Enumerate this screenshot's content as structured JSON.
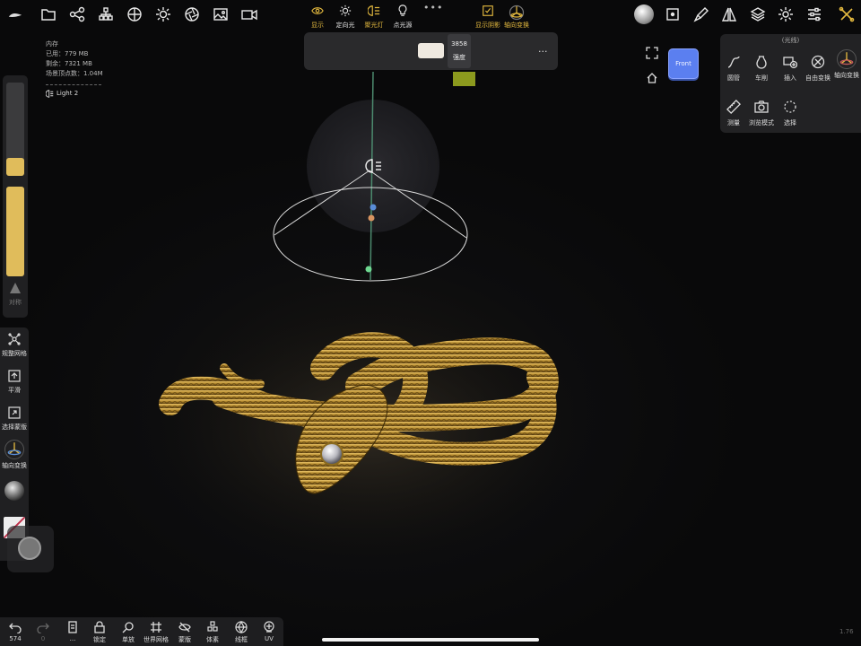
{
  "top_toolbar": {
    "left_icons": [
      "nomad-logo-icon",
      "folder-icon",
      "share-graph-icon",
      "scene-tree-icon",
      "material-grid-icon",
      "sun-icon",
      "aperture-icon",
      "image-icon",
      "video-icon"
    ],
    "right_icons": [
      "material-ball-icon",
      "mask-icon",
      "paint-brush-icon",
      "symmetry-icon",
      "layers-icon",
      "gear-icon",
      "sliders-icon",
      "tools-icon"
    ]
  },
  "memory": {
    "title": "内存",
    "used": "已用：779 MB",
    "free": "剩余：7321 MB",
    "vertices": "场景顶点数：1.04M"
  },
  "light_label": "Light 2",
  "light_toolbar": {
    "items": [
      {
        "label": "显示",
        "icon": "eye-icon"
      },
      {
        "label": "定向光",
        "icon": "sun-icon"
      },
      {
        "label": "聚光灯",
        "icon": "spotlight-icon"
      },
      {
        "label": "点光源",
        "icon": "lightbulb-icon"
      }
    ],
    "intensity_value": "3858",
    "intensity_label": "强度",
    "shadow_label": "显示阴影",
    "transform_label": "轴向变换",
    "more": "..."
  },
  "view_cube_label": "Front",
  "right_panel": {
    "title": "(光线)",
    "tools": [
      {
        "label": "圆管",
        "icon": "tube-curve-icon"
      },
      {
        "label": "车削",
        "icon": "lathe-vase-icon"
      },
      {
        "label": "插入",
        "icon": "insert-plus-icon"
      },
      {
        "label": "自由变换",
        "icon": "free-transform-icon"
      },
      {
        "label": "轴向变换",
        "icon": "gizmo-icon"
      },
      {
        "label": "测量",
        "icon": "ruler-icon"
      },
      {
        "label": "浏览模式",
        "icon": "camera-icon"
      },
      {
        "label": "选择",
        "icon": "lasso-select-icon"
      }
    ]
  },
  "left_sliders": {
    "symmetry_label": "对称",
    "radius_level": 0.1,
    "intensity_level": 1.0
  },
  "left_tools": [
    {
      "label": "规整网格",
      "icon": "remesh-icon"
    },
    {
      "label": "平滑",
      "icon": "smooth-icon"
    },
    {
      "label": "选择蒙版",
      "icon": "select-mask-icon"
    },
    {
      "label": "轴向变换",
      "icon": "gizmo-icon"
    }
  ],
  "bottom_bar": {
    "undo_count": "574",
    "redo_count": "0",
    "items": [
      {
        "label": "...",
        "icon": "menu-icon"
      },
      {
        "label": "锁定",
        "icon": "lock-icon"
      },
      {
        "label": "单放",
        "icon": "solo-search-icon"
      },
      {
        "label": "世界网格",
        "icon": "grid-icon"
      },
      {
        "label": "蒙版",
        "icon": "hide-eye-icon"
      },
      {
        "label": "体素",
        "icon": "voxel-icon"
      },
      {
        "label": "线框",
        "icon": "wireframe-icon"
      },
      {
        "label": "UV",
        "icon": "uv-icon"
      }
    ]
  },
  "version": "1.76",
  "colors": {
    "accent": "#e3b93f",
    "panel": "#222224",
    "cube": "#5b7ff0",
    "gold": "#b8902e"
  }
}
